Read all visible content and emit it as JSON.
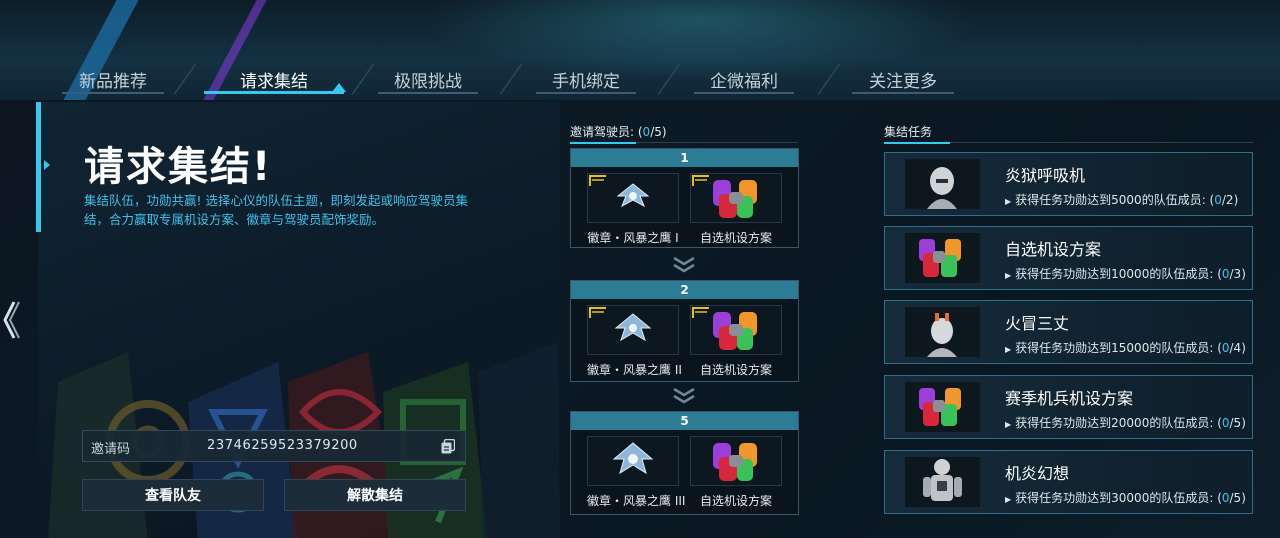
{
  "tabs": [
    {
      "label": "新品推荐",
      "active": false
    },
    {
      "label": "请求集结",
      "active": true
    },
    {
      "label": "极限挑战",
      "active": false
    },
    {
      "label": "手机绑定",
      "active": false
    },
    {
      "label": "企微福利",
      "active": false
    },
    {
      "label": "关注更多",
      "active": false
    }
  ],
  "hero": {
    "title": "请求集结!",
    "description": "集结队伍，功勋共赢! 选择心仪的队伍主题，即刻发起或响应驾驶员集结，合力赢取专属机设方案、徽章与驾驶员配饰奖励。"
  },
  "invite": {
    "label": "邀请码",
    "code": "23746259523379200"
  },
  "buttons": {
    "view_teammates": "查看队友",
    "disband": "解散集结"
  },
  "invite_pilots": {
    "label": "邀请驾驶员: ",
    "count_current": "0",
    "count_suffix": "/5)",
    "count_prefix": "("
  },
  "tiers": [
    {
      "level": "1",
      "badge_label": "徽章・风暴之鹰 I",
      "blueprint_label": "自选机设方案"
    },
    {
      "level": "2",
      "badge_label": "徽章・风暴之鹰 II",
      "blueprint_label": "自选机设方案"
    },
    {
      "level": "5",
      "badge_label": "徽章・风暴之鹰 III",
      "blueprint_label": "自选机设方案"
    }
  ],
  "tasks_section": {
    "label": "集结任务"
  },
  "tasks": [
    {
      "name": "炎狱呼吸机",
      "cond_text": "获得任务功勋达到5000的队伍成员: (",
      "progress": "0",
      "total": "/2)",
      "thumb": "mech-head"
    },
    {
      "name": "自选机设方案",
      "cond_text": "获得任务功勋达到10000的队伍成员: (",
      "progress": "0",
      "total": "/3)",
      "thumb": "paint-cans"
    },
    {
      "name": "火冒三丈",
      "cond_text": "获得任务功勋达到15000的队伍成员: (",
      "progress": "0",
      "total": "/4)",
      "thumb": "mech-head-flame"
    },
    {
      "name": "赛季机兵机设方案",
      "cond_text": "获得任务功勋达到20000的队伍成员: (",
      "progress": "0",
      "total": "/5)",
      "thumb": "paint-cans"
    },
    {
      "name": "机炎幻想",
      "cond_text": "获得任务功勋达到30000的队伍成员: (",
      "progress": "0",
      "total": "/5)",
      "thumb": "mech-body"
    }
  ],
  "colors": {
    "accent": "#35c9ef",
    "tier_header": "#2d7c95"
  }
}
